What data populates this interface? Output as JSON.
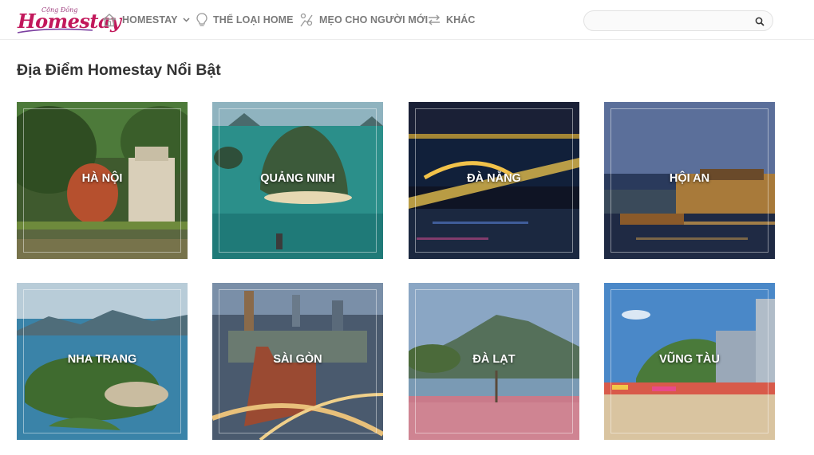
{
  "header": {
    "logo_small": "Cộng Đồng",
    "logo_big": "Homestay",
    "nav": [
      {
        "label": "HOMESTAY",
        "icon": "home-icon",
        "has_dropdown": true
      },
      {
        "label": "THỂ LOẠI HOME",
        "icon": "lightbulb-icon"
      },
      {
        "label": "MẸO CHO NGƯỜI MỚI",
        "icon": "tips-icon"
      },
      {
        "label": "KHÁC",
        "icon": "exchange-icon"
      }
    ],
    "search_placeholder": "",
    "search_icon": "search-icon"
  },
  "section": {
    "title": "Địa Điểm Homestay Nổi Bật",
    "places": [
      {
        "name": "HÀ NỘI"
      },
      {
        "name": "QUẢNG NINH"
      },
      {
        "name": "ĐÀ NẴNG"
      },
      {
        "name": "HỘI AN"
      },
      {
        "name": "NHA TRANG"
      },
      {
        "name": "SÀI GÒN"
      },
      {
        "name": "ĐÀ LẠT"
      },
      {
        "name": "VŨNG TÀU"
      }
    ]
  }
}
